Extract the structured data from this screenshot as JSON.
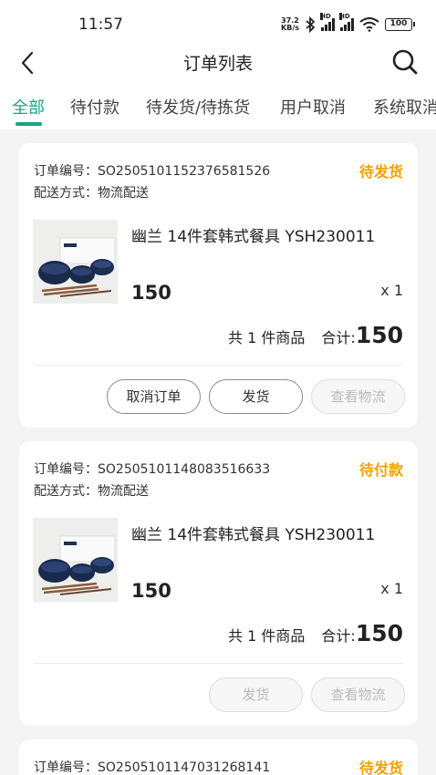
{
  "statusbar": {
    "time": "11:57",
    "net_speed_value": "37.2",
    "net_speed_unit": "KB/s",
    "signal1_label": "HD",
    "signal2_label": "HD",
    "battery": "100",
    "icons": [
      "bluetooth-icon",
      "signal-icon",
      "signal-icon",
      "wifi-icon",
      "battery-icon"
    ]
  },
  "nav": {
    "title": "订单列表",
    "back_icon": "chevron-left-icon",
    "search_icon": "search-icon"
  },
  "tabs": [
    {
      "label": "全部",
      "active": true
    },
    {
      "label": "待付款",
      "active": false
    },
    {
      "label": "待发货/待拣货",
      "active": false
    },
    {
      "label": "用户取消",
      "active": false
    },
    {
      "label": "系统取消",
      "active": false
    }
  ],
  "colors": {
    "accent": "#1aa287",
    "status": "#f2a100",
    "background": "#f4f4f4"
  },
  "orders": [
    {
      "order_no_label": "订单编号：",
      "order_no": "SO2505101152376581526",
      "ship_label": "配送方式：",
      "ship_method": "物流配送",
      "status": "待发货",
      "product_name": "幽兰 14件套韩式餐具 YSH230011",
      "price": "150",
      "qty": "x 1",
      "count_text": "共 1 件商品",
      "total_label": "合计:",
      "total": "150",
      "buttons": [
        {
          "label": "取消订单",
          "disabled": false
        },
        {
          "label": "发货",
          "disabled": false
        },
        {
          "label": "查看物流",
          "disabled": true
        }
      ]
    },
    {
      "order_no_label": "订单编号：",
      "order_no": "SO2505101148083516633",
      "ship_label": "配送方式：",
      "ship_method": "物流配送",
      "status": "待付款",
      "product_name": "幽兰 14件套韩式餐具 YSH230011",
      "price": "150",
      "qty": "x 1",
      "count_text": "共 1 件商品",
      "total_label": "合计:",
      "total": "150",
      "buttons": [
        {
          "label": "发货",
          "disabled": true
        },
        {
          "label": "查看物流",
          "disabled": true
        }
      ]
    },
    {
      "order_no_label": "订单编号：",
      "order_no": "SO2505101147031268141",
      "status": "待发货"
    }
  ]
}
